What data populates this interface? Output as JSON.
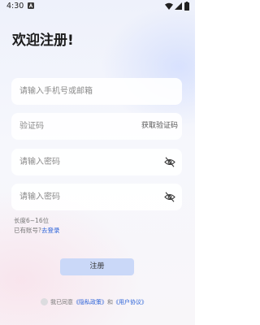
{
  "status_bar": {
    "time": "4:30",
    "app_icon": "a-square-icon",
    "wifi_icon": "wifi-icon",
    "signal_icon": "signal-icon",
    "battery_icon": "battery-icon"
  },
  "title": "欢迎注册!",
  "form": {
    "phone_placeholder": "请输入手机号或邮箱",
    "code_placeholder": "验证码",
    "get_code_label": "获取验证码",
    "password_placeholder": "请输入密码",
    "confirm_password_placeholder": "请输入密码",
    "eye_icon": "eye-off-icon"
  },
  "hints": {
    "length": "长度6~16位",
    "have_account": "已有账号?",
    "login_link": "去登录"
  },
  "register_label": "注册",
  "agreement": {
    "prefix": "我已同意",
    "privacy_link": "《隐私政策》",
    "and": "和",
    "user_link": "《用户协议》"
  },
  "colors": {
    "link": "#2c63d8",
    "button_bg": "#cad8f8",
    "title": "#1b1b1b"
  }
}
